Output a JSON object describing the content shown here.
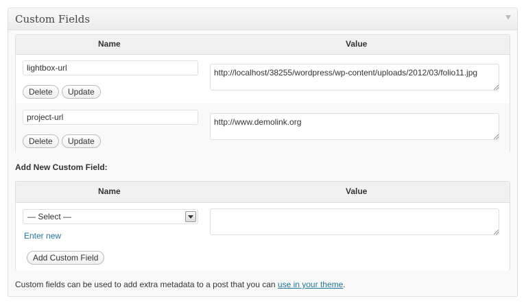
{
  "metabox": {
    "title": "Custom Fields"
  },
  "existing": {
    "col_name": "Name",
    "col_value": "Value",
    "rows": [
      {
        "key": "lightbox-url",
        "value": "http://localhost/38255/wordpress/wp-content/uploads/2012/03/folio11.jpg",
        "delete_label": "Delete",
        "update_label": "Update"
      },
      {
        "key": "project-url",
        "value": "http://www.demolink.org",
        "delete_label": "Delete",
        "update_label": "Update"
      }
    ]
  },
  "add_new": {
    "heading": "Add New Custom Field:",
    "col_name": "Name",
    "col_value": "Value",
    "select_value": "— Select —",
    "enter_new": "Enter new",
    "add_button": "Add Custom Field"
  },
  "footer": {
    "note_prefix": "Custom fields can be used to add extra metadata to a post that you can ",
    "note_link": "use in your theme",
    "note_suffix": "."
  }
}
